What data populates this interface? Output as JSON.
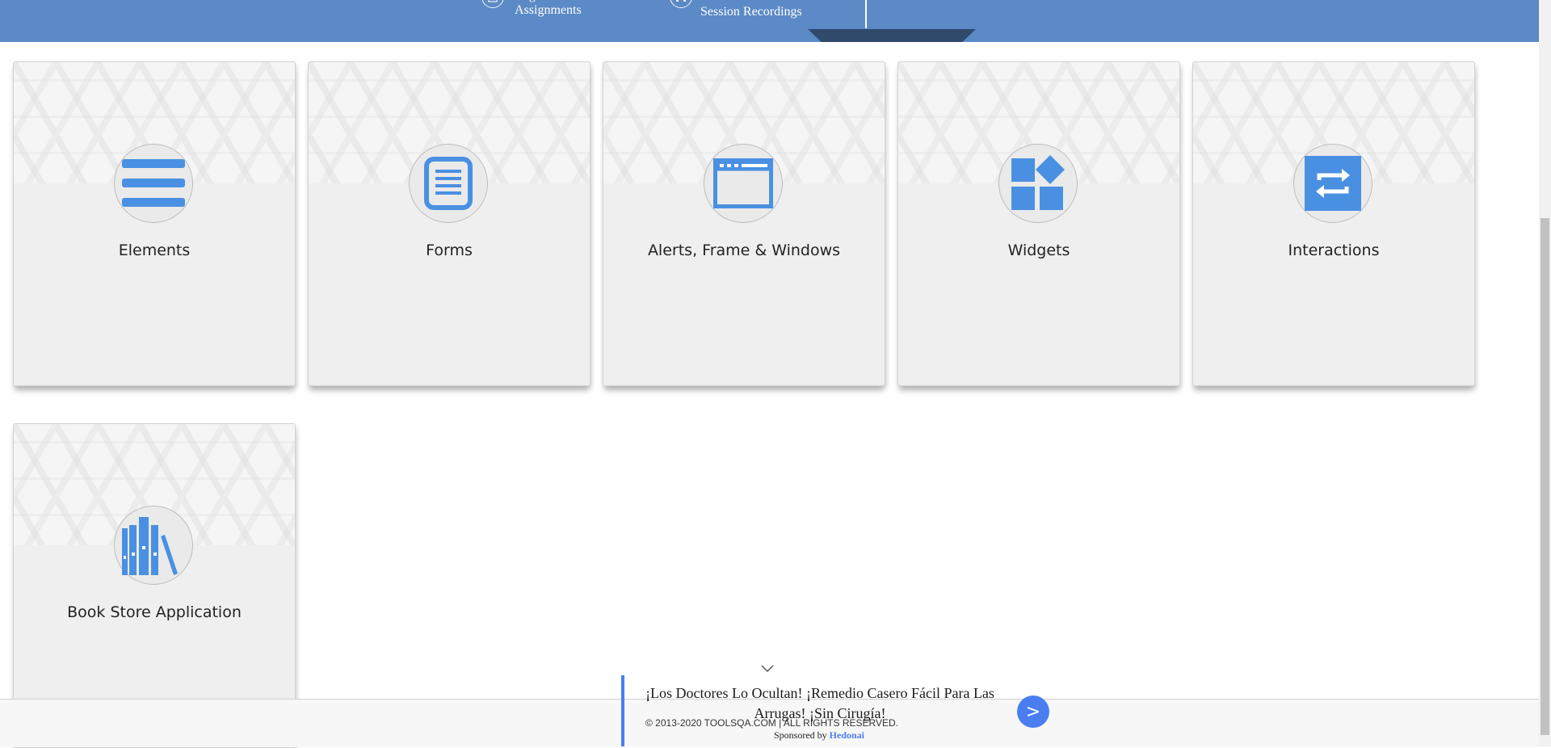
{
  "banner": {
    "items": [
      {
        "label": "Regular Assignments",
        "icon": "document-icon"
      },
      {
        "label": "Session Recordings",
        "icon": "headphones-icon"
      }
    ]
  },
  "cards": [
    {
      "label": "Elements",
      "icon": "hamburger-list-icon"
    },
    {
      "label": "Forms",
      "icon": "form-document-icon"
    },
    {
      "label": "Alerts, Frame & Windows",
      "icon": "browser-window-icon"
    },
    {
      "label": "Widgets",
      "icon": "widgets-grid-icon"
    },
    {
      "label": "Interactions",
      "icon": "repeat-arrows-icon"
    },
    {
      "label": "Book Store Application",
      "icon": "books-icon"
    }
  ],
  "footer": {
    "copyright": "© 2013-2020 TOOLSQA.COM | ALL RIGHTS RESERVED."
  },
  "ad": {
    "headline": "¡Los Doctores Lo Ocultan! ¡Remedio Casero Fácil Para Las Arrugas! ¡Sin Cirugía!",
    "sponsored_prefix": "Sponsored by",
    "sponsor": "Hedonai",
    "next_label": ">"
  },
  "colors": {
    "banner": "#5b8ac6",
    "icon_blue": "#4a90e2",
    "ad_accent": "#4a7ef0"
  }
}
